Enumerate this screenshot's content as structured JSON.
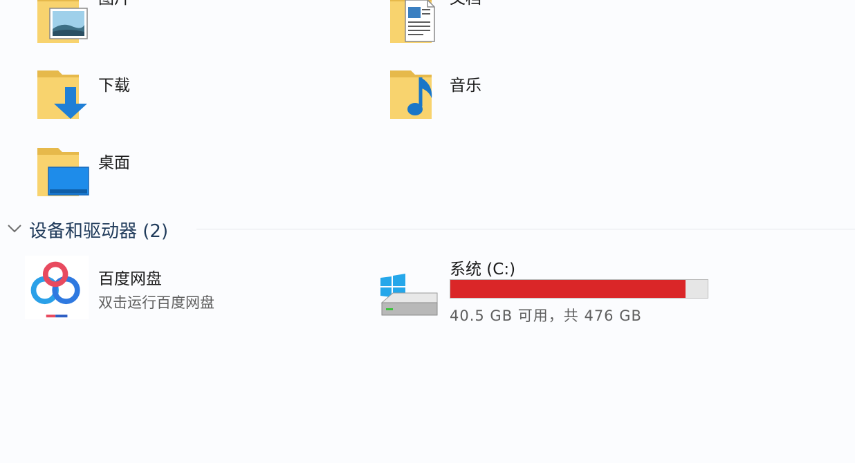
{
  "folders": [
    {
      "label": "图片",
      "icon": "pictures-folder-icon"
    },
    {
      "label": "文档",
      "icon": "documents-folder-icon"
    },
    {
      "label": "下载",
      "icon": "downloads-folder-icon"
    },
    {
      "label": "音乐",
      "icon": "music-folder-icon"
    },
    {
      "label": "桌面",
      "icon": "desktop-folder-icon"
    }
  ],
  "devices_section": {
    "title": "设备和驱动器 (2)",
    "icon": "chevron-down-icon"
  },
  "devices": [
    {
      "name": "百度网盘",
      "subtitle": "双击运行百度网盘",
      "icon": "baidu-netdisk-icon"
    },
    {
      "name": "系统 (C:)",
      "space_text": "40.5 GB 可用，共 476 GB",
      "used_fraction": 0.915,
      "icon": "windows-drive-icon",
      "bar_color": "#da2628"
    }
  ]
}
